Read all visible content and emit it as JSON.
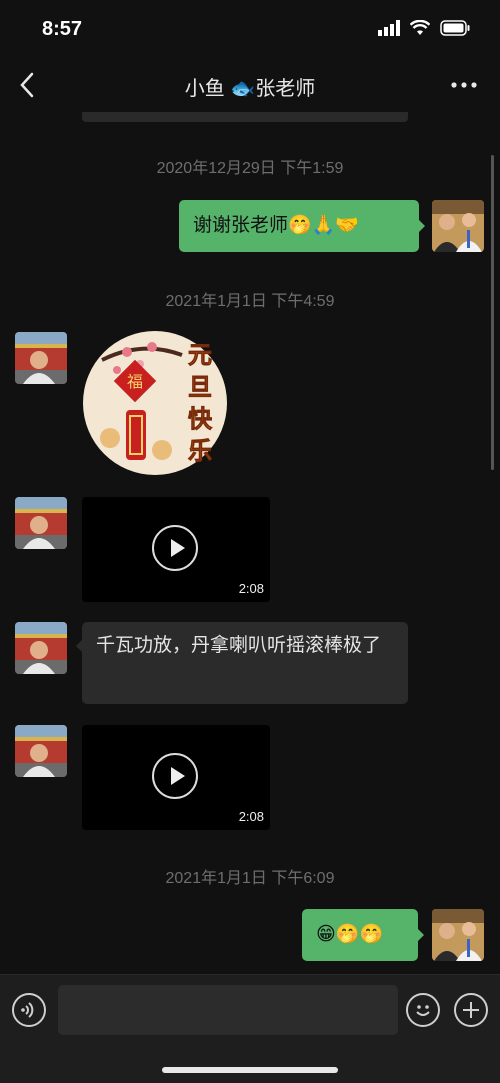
{
  "status_bar": {
    "time": "8:57"
  },
  "nav": {
    "title": "小鱼 🐟张老师",
    "back_icon": "chevron-left-icon",
    "more_icon": "more-dots-icon"
  },
  "messages": {
    "ts1": "2020年12月29日 下午1:59",
    "out1": "谢谢张老师🤭🙏🤝",
    "ts2": "2021年1月1日 下午4:59",
    "sticker": {
      "vertical_text": "元旦快乐",
      "fu": "福"
    },
    "video1_duration": "2:08",
    "in_text": "千瓦功放，丹拿喇叭听摇滚棒极了",
    "video2_duration": "2:08",
    "ts3": "2021年1月1日 下午6:09",
    "out2": "😁🤭🤭"
  },
  "input_bar": {
    "placeholder": "",
    "voice_icon": "voice-icon",
    "emoji_icon": "emoji-icon",
    "plus_icon": "plus-icon"
  },
  "colors": {
    "background": "#111111",
    "outgoing_bubble": "#56b46a",
    "incoming_bubble": "#2b2b2b",
    "timestamp": "#6e6e6e"
  }
}
